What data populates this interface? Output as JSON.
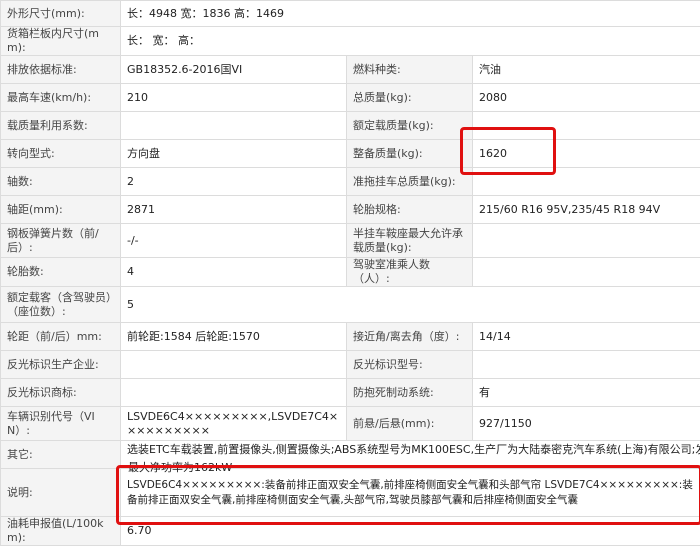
{
  "rows": [
    {
      "label": "外形尺寸(mm):",
      "value": "长：4948 宽：1836 高：1469"
    },
    {
      "label": "货箱栏板内尺寸(mm):",
      "value": "长： 宽： 高："
    },
    {
      "label": "排放依据标准:",
      "value": "GB18352.6-2016国VI",
      "label2": "燃料种类:",
      "value2": "汽油"
    },
    {
      "label": "最高车速(km/h):",
      "value": "210",
      "label2": "总质量(kg):",
      "value2": "2080"
    },
    {
      "label": "载质量利用系数:",
      "value": "",
      "label2": "额定载质量(kg):",
      "value2": ""
    },
    {
      "label": "转向型式:",
      "value": "方向盘",
      "label2": "整备质量(kg):",
      "value2": "1620"
    },
    {
      "label": "轴数:",
      "value": "2",
      "label2": "准拖挂车总质量(kg):",
      "value2": ""
    },
    {
      "label": "轴距(mm):",
      "value": "2871",
      "label2": "轮胎规格:",
      "value2": "215/60 R16 95V,235/45 R18 94V"
    },
    {
      "label": "钢板弹簧片数（前/后）:",
      "value": "-/-",
      "label2": "半挂车鞍座最大允许承载质量(kg):",
      "value2": ""
    },
    {
      "label": "轮胎数:",
      "value": "4",
      "label2": "驾驶室准乘人数（人）:",
      "value2": ""
    },
    {
      "label": "额定载客（含驾驶员）（座位数）:",
      "value": "5"
    },
    {
      "label": "轮距（前/后）mm:",
      "value": "前轮距:1584 后轮距:1570",
      "label2": "接近角/离去角（度）:",
      "value2": "14/14"
    },
    {
      "label": "反光标识生产企业:",
      "value": "",
      "label2": "反光标识型号:",
      "value2": ""
    },
    {
      "label": "反光标识商标:",
      "value": "",
      "label2": "防抱死制动系统:",
      "value2": "有"
    },
    {
      "label": "车辆识别代号（VIN）:",
      "value": "LSVDE6C4×××××××××,LSVDE7C4××××××××××",
      "label2": "前悬/后悬(mm):",
      "value2": "927/1150"
    },
    {
      "label": "其它:",
      "value": "选装ETC车载装置,前置摄像头,侧置摄像头;ABS系统型号为MK100ESC,生产厂为大陆泰密克汽车系统(上海)有限公司;发动机"
    },
    {
      "label": "说明:",
      "value": "LSVDE6C4×××××××××:装备前排正面双安全气囊,前排座椅侧面安全气囊和头部气帘 LSVDE7C4×××××××××:装备前排正面双安全气囊,前排座椅侧面安全气囊,头部气帘,驾驶员膝部气囊和后排座椅侧面安全气囊"
    },
    {
      "label": "油耗申报值(L/100km):",
      "value": "6.70"
    }
  ],
  "overlap_text": "最大净功率为162kW",
  "highlight_color": "#e01010"
}
